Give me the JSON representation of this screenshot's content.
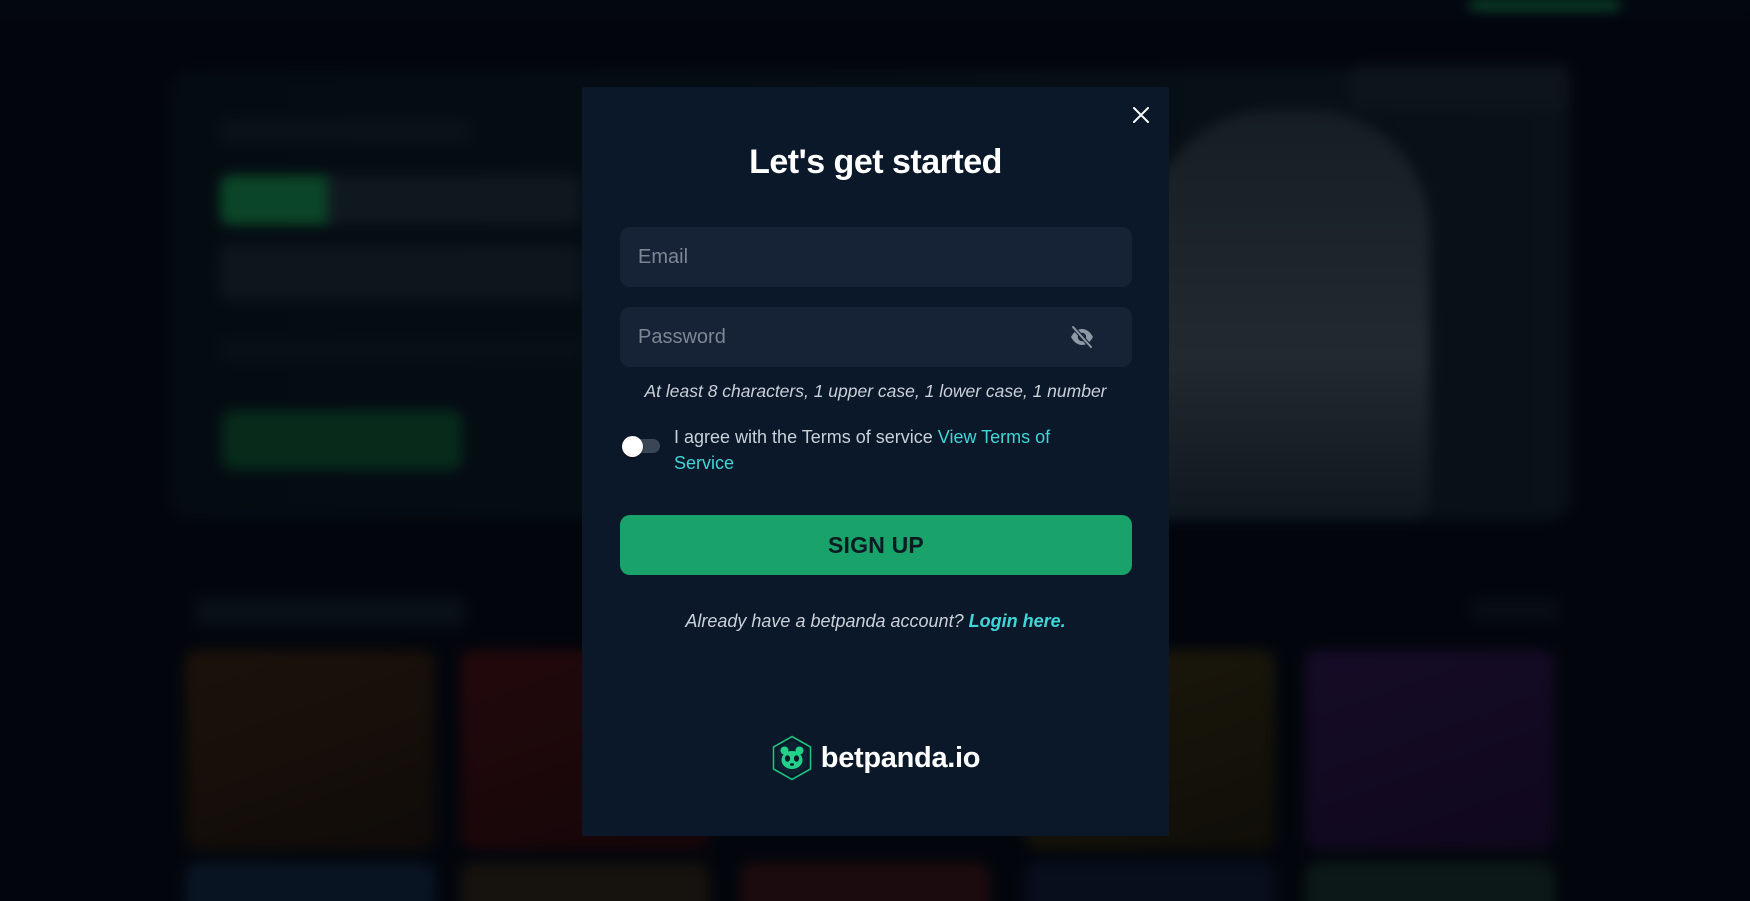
{
  "modal": {
    "title": "Let's get started",
    "close_icon": "close-icon",
    "email": {
      "placeholder": "Email",
      "value": ""
    },
    "password": {
      "placeholder": "Password",
      "value": "",
      "toggle_icon": "eye-off-icon"
    },
    "password_hint": "At least 8 characters, 1 upper case, 1 lower case, 1 number",
    "terms": {
      "agreed": false,
      "text": "I agree with the Terms of service",
      "link_label": "View Terms of Service"
    },
    "signup_label": "SIGN UP",
    "login_prompt": "Already have a betpanda account?",
    "login_link": "Login here.",
    "brand": {
      "name": "betpanda.io",
      "logo_icon": "panda-hexagon-logo"
    }
  },
  "colors": {
    "modal_bg": "#0b1829",
    "input_bg": "#162337",
    "accent_green": "#19a36b",
    "link_cyan": "#3fd6d8",
    "text_muted": "#c9d0d8"
  }
}
